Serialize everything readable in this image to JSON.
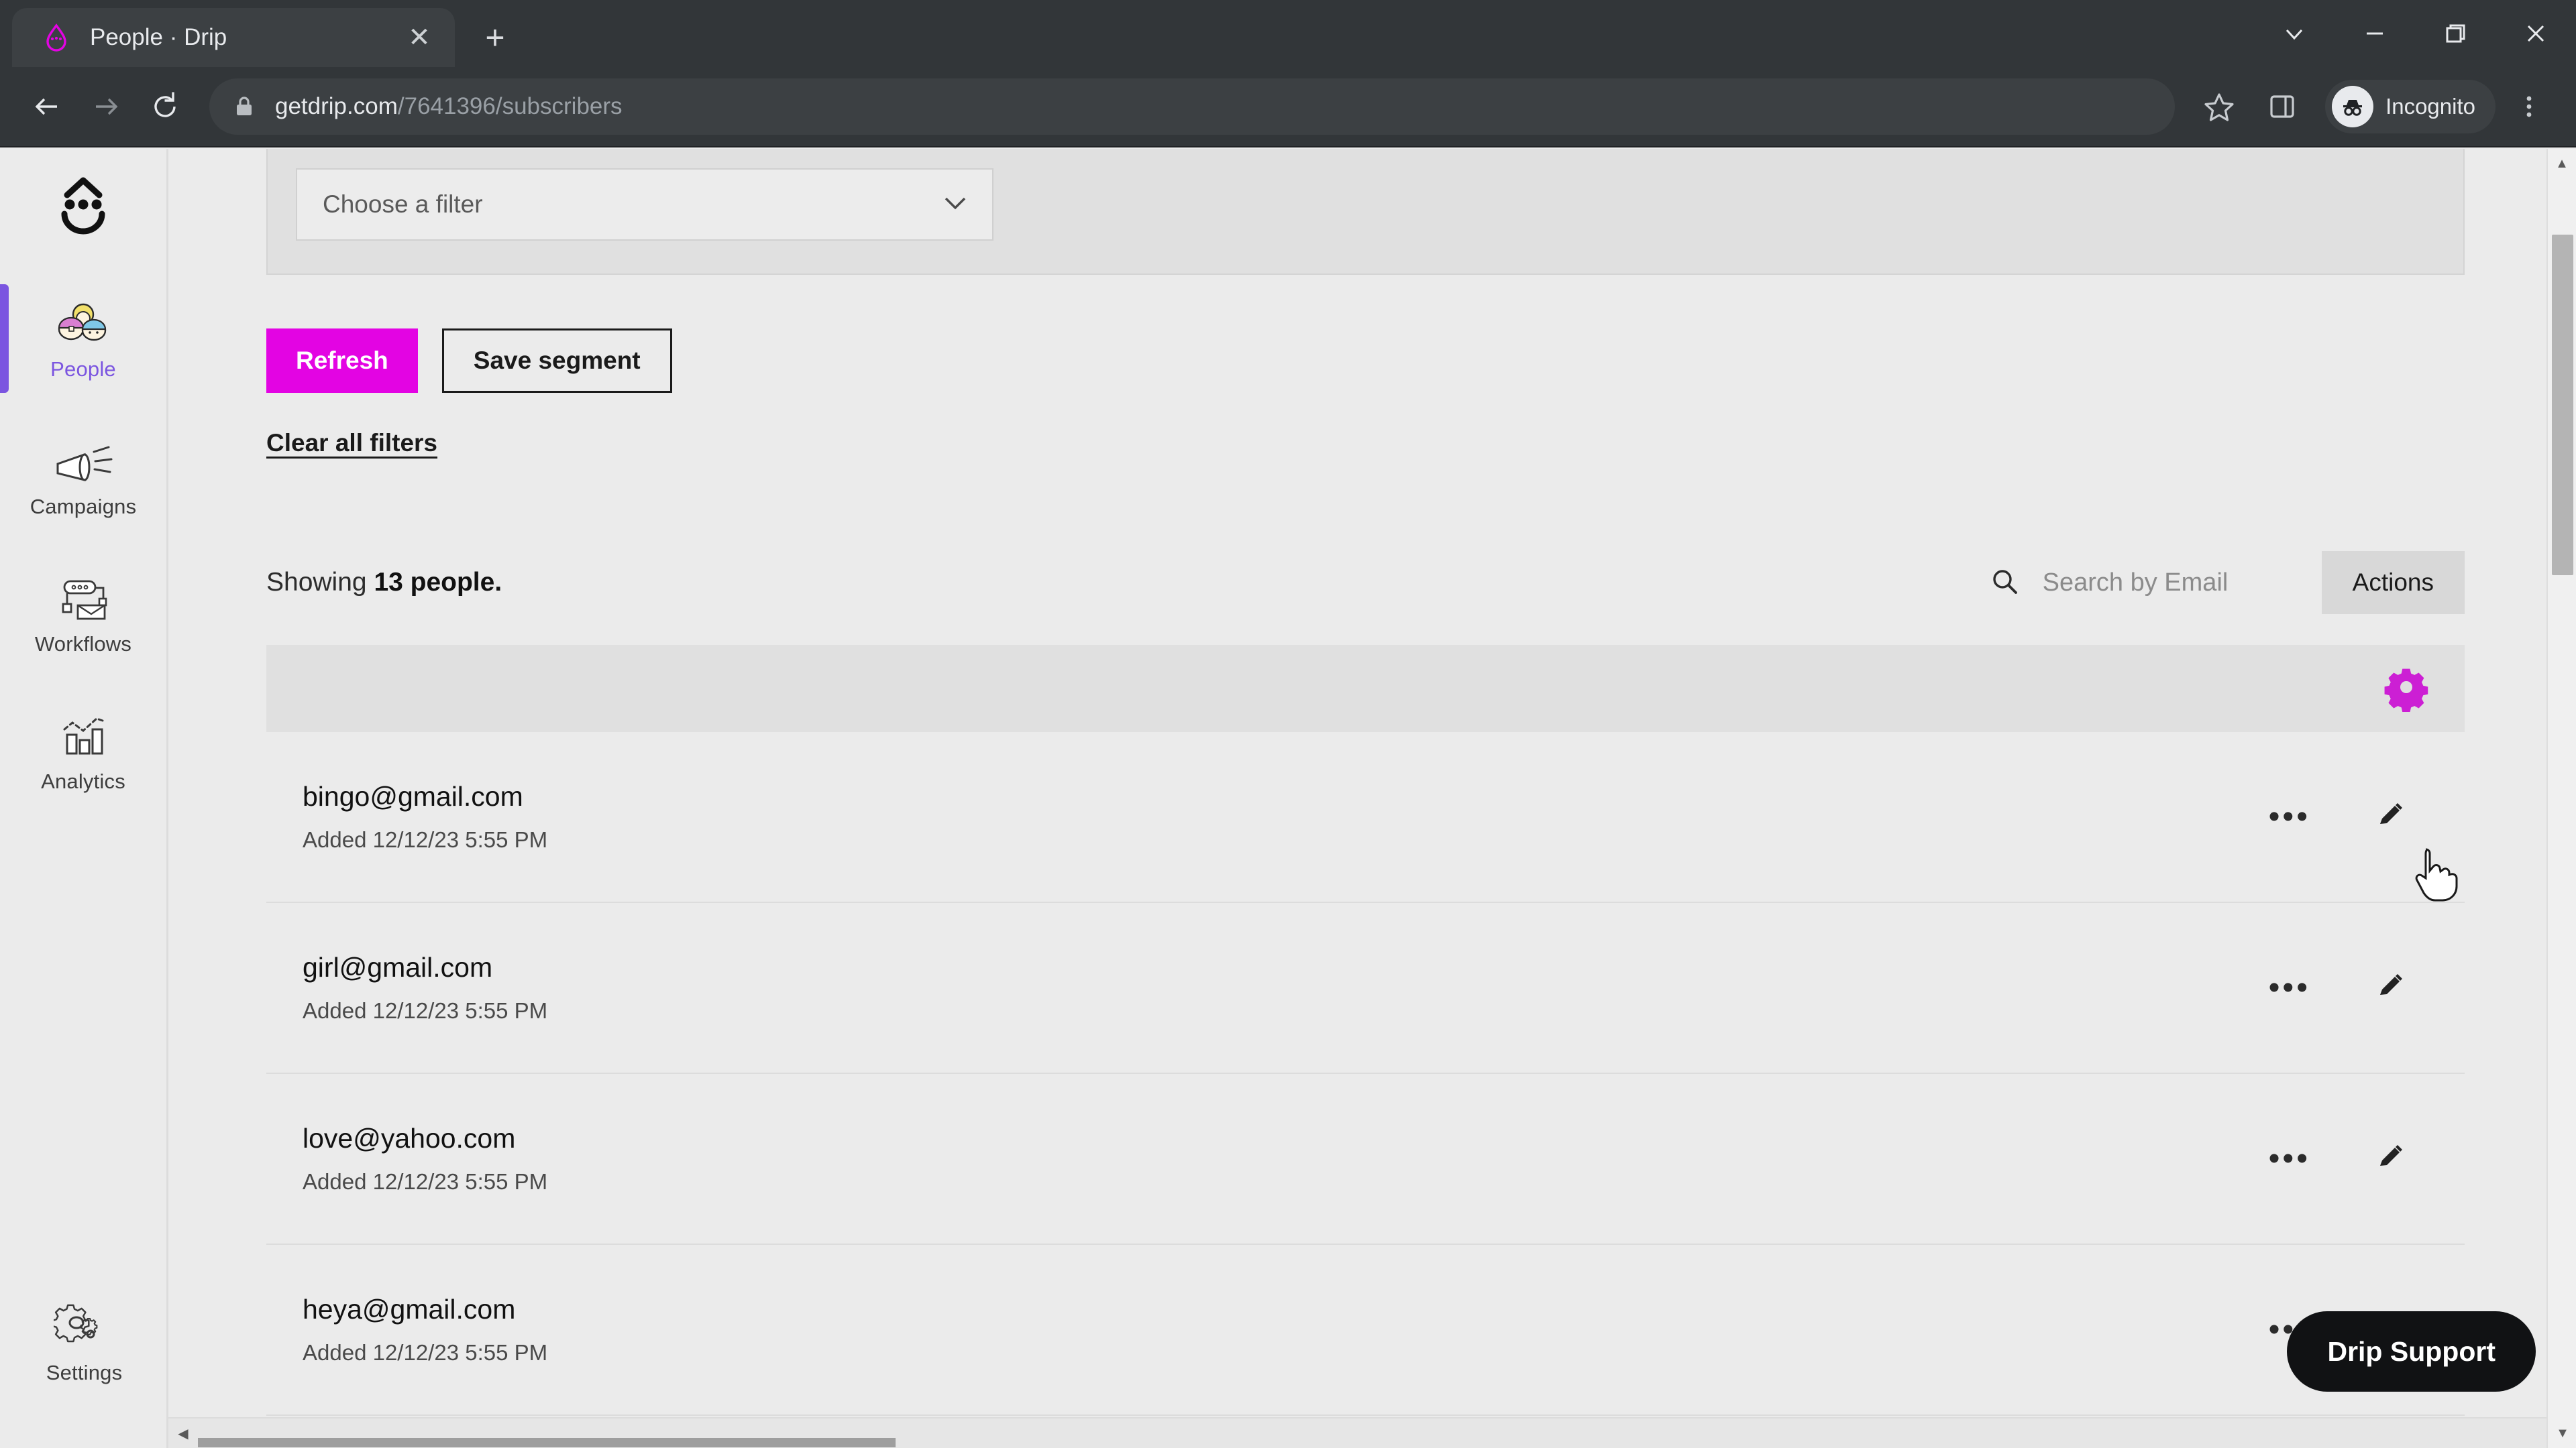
{
  "browser": {
    "tab": {
      "title": "People · Drip",
      "favicon_icon": "drip-logo-icon",
      "close_icon": "close-icon"
    },
    "new_tab_icon": "plus-icon",
    "window_controls": [
      {
        "name": "tab-search-button",
        "icon": "chevron-down-icon",
        "glyph": "⌄"
      },
      {
        "name": "minimize-button",
        "icon": "minimize-icon",
        "glyph": "—"
      },
      {
        "name": "maximize-button",
        "icon": "restore-icon",
        "glyph": "❐"
      },
      {
        "name": "close-window-button",
        "icon": "close-icon",
        "glyph": "✕"
      }
    ],
    "nav": {
      "back_icon": "arrow-left-icon",
      "forward_icon": "arrow-right-icon",
      "reload_icon": "reload-icon"
    },
    "omnibox": {
      "lock_icon": "lock-icon",
      "url_domain": "getdrip.com",
      "url_path": "/7641396/subscribers"
    },
    "toolbar_right": {
      "bookmark_icon": "star-icon",
      "side_panel_icon": "side-panel-icon",
      "profile_icon": "incognito-icon",
      "profile_label": "Incognito",
      "menu_icon": "kebab-menu-icon"
    }
  },
  "sidebar": {
    "brand_icon": "drip-smiley-logo",
    "items": [
      {
        "label": "People",
        "icon": "people-icon",
        "active": true
      },
      {
        "label": "Campaigns",
        "icon": "megaphone-icon",
        "active": false
      },
      {
        "label": "Workflows",
        "icon": "workflow-icon",
        "active": false
      },
      {
        "label": "Analytics",
        "icon": "bar-chart-icon",
        "active": false
      }
    ],
    "settings": {
      "label": "Settings",
      "icon": "gear-icon"
    },
    "active_color": "#7b55e0"
  },
  "filters": {
    "select_placeholder": "Choose a filter",
    "chevron_icon": "chevron-down-icon",
    "refresh_label": "Refresh",
    "refresh_color": "#e304e3",
    "save_segment_label": "Save segment",
    "clear_label": "Clear all filters"
  },
  "list_header": {
    "showing_prefix": "Showing ",
    "showing_count": "13 people.",
    "search_icon": "search-icon",
    "search_value": "",
    "search_placeholder": "Search by Email",
    "actions_label": "Actions"
  },
  "table": {
    "settings_gear_icon": "gear-icon",
    "settings_gear_color": "#cc1fd4",
    "row_menu_icon": "ellipsis-icon",
    "row_edit_icon": "pencil-icon",
    "rows": [
      {
        "email": "bingo@gmail.com",
        "added": "Added 12/12/23 5:55 PM"
      },
      {
        "email": "girl@gmail.com",
        "added": "Added 12/12/23 5:55 PM"
      },
      {
        "email": "love@yahoo.com",
        "added": "Added 12/12/23 5:55 PM"
      },
      {
        "email": "heya@gmail.com",
        "added": "Added 12/12/23 5:55 PM"
      }
    ]
  },
  "support": {
    "label": "Drip Support"
  },
  "scrollbars": {
    "vertical_up_icon": "caret-up-icon",
    "vertical_down_icon": "caret-down-icon",
    "horizontal_left_icon": "caret-left-icon"
  },
  "cursor": {
    "icon": "pointing-hand-cursor"
  }
}
